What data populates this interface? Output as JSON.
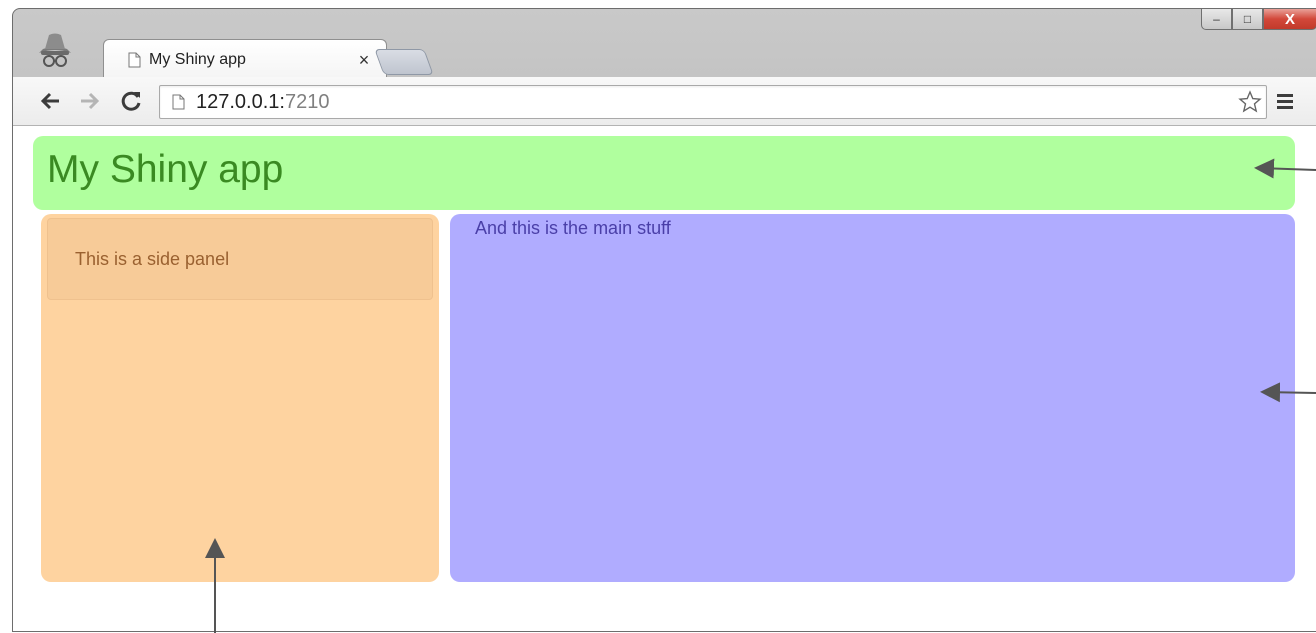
{
  "browser": {
    "tab_title": "My Shiny app",
    "tab_close": "×",
    "url_host": "127.0.0.1:",
    "url_port": "7210",
    "window_controls": {
      "minimize": "–",
      "maximize": "□",
      "close": "X"
    }
  },
  "app": {
    "title": "My Shiny app",
    "side_panel_text": "This is a side panel",
    "main_panel_text": "And this is the main stuff"
  },
  "colors": {
    "header_panel": "#b0ff9e",
    "side_panel": "#fed3a0",
    "main_panel": "#b0acff"
  },
  "icons": {
    "incognito": "incognito-icon",
    "back": "back-arrow-icon",
    "forward": "forward-arrow-icon",
    "reload": "reload-icon",
    "page": "page-icon",
    "star": "star-icon",
    "menu": "menu-icon"
  }
}
